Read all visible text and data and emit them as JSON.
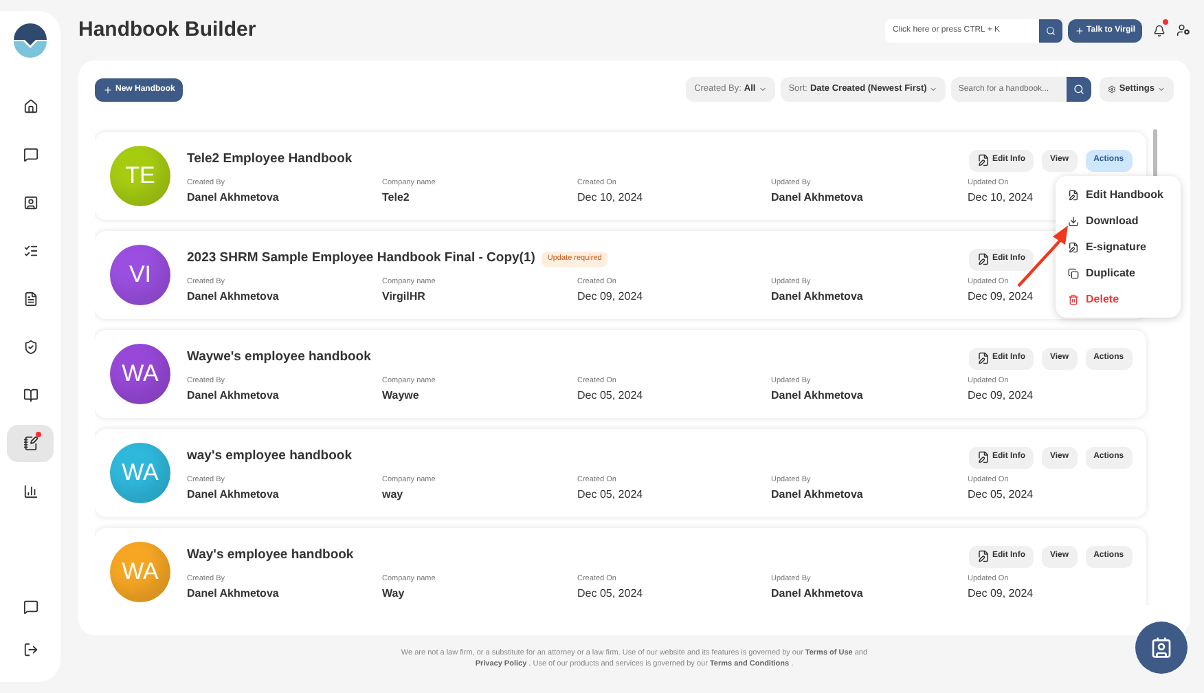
{
  "sidebar": {
    "items": [
      {
        "selected": false,
        "notification": false
      },
      {
        "selected": false,
        "notification": false
      },
      {
        "selected": false,
        "notification": false
      },
      {
        "selected": false,
        "notification": false
      },
      {
        "selected": false,
        "notification": false
      },
      {
        "selected": false,
        "notification": false
      },
      {
        "selected": false,
        "notification": false
      },
      {
        "selected": true,
        "notification": true
      },
      {
        "selected": false,
        "notification": false
      }
    ]
  },
  "header": {
    "title": "Handbook Builder",
    "search": {
      "placeholder": "Click here or press CTRL + K"
    },
    "talk_button": "Talk to Virgil",
    "notification": true
  },
  "toolbar": {
    "new_button": "New Handbook",
    "created_by": {
      "label": "Created By:",
      "value": "All"
    },
    "sort": {
      "label": "Sort:",
      "value": "Date Created (Newest First)"
    },
    "search": {
      "placeholder": "Search for a handbook..."
    },
    "settings": "Settings"
  },
  "handbooks": [
    {
      "initials": "TE",
      "color": "#a6cc12",
      "title": "Tele2 Employee Handbook",
      "fields": [
        {
          "label": "Created By",
          "value": "Danel Akhmetova"
        },
        {
          "label": "Company name",
          "value": "Tele2"
        },
        {
          "label": "Created On",
          "value": "Dec 10, 2024"
        },
        {
          "label": "Updated By",
          "value": "Danel Akhmetova"
        },
        {
          "label": "Updated On",
          "value": "Dec 10, 2024"
        }
      ],
      "buttons": [
        {
          "kind": "edit",
          "label": "Edit Info",
          "selected": false
        },
        {
          "kind": "view",
          "label": "View",
          "selected": false
        },
        {
          "kind": "actions",
          "label": "Actions",
          "selected": true
        }
      ]
    },
    {
      "initials": "VI",
      "color": "#9a4fe0",
      "title": "2023 SHRM Sample Employee Handbook Final - Copy(1)",
      "badge": "Update required",
      "fields": [
        {
          "label": "Created By",
          "value": "Danel Akhmetova"
        },
        {
          "label": "Company name",
          "value": "VirgilHR"
        },
        {
          "label": "Created On",
          "value": "Dec 09, 2024"
        },
        {
          "label": "Updated By",
          "value": "Danel Akhmetova"
        },
        {
          "label": "Updated On",
          "value": "Dec 09, 2024"
        }
      ],
      "buttons": [
        {
          "kind": "edit",
          "label": "Edit Info",
          "selected": false
        }
      ]
    },
    {
      "initials": "WA",
      "color": "#9748d8",
      "title": "Waywe's employee handbook",
      "fields": [
        {
          "label": "Created By",
          "value": "Danel Akhmetova"
        },
        {
          "label": "Company name",
          "value": "Waywe"
        },
        {
          "label": "Created On",
          "value": "Dec 05, 2024"
        },
        {
          "label": "Updated By",
          "value": "Danel Akhmetova"
        },
        {
          "label": "Updated On",
          "value": "Dec 09, 2024"
        }
      ],
      "buttons": [
        {
          "kind": "edit",
          "label": "Edit Info",
          "selected": false
        },
        {
          "kind": "view",
          "label": "View",
          "selected": false
        },
        {
          "kind": "actions",
          "label": "Actions",
          "selected": false
        }
      ]
    },
    {
      "initials": "WA",
      "color": "#2fb8dc",
      "title": "way's employee handbook",
      "fields": [
        {
          "label": "Created By",
          "value": "Danel Akhmetova"
        },
        {
          "label": "Company name",
          "value": "way"
        },
        {
          "label": "Created On",
          "value": "Dec 05, 2024"
        },
        {
          "label": "Updated By",
          "value": "Danel Akhmetova"
        },
        {
          "label": "Updated On",
          "value": "Dec 05, 2024"
        }
      ],
      "buttons": [
        {
          "kind": "edit",
          "label": "Edit Info",
          "selected": false
        },
        {
          "kind": "view",
          "label": "View",
          "selected": false
        },
        {
          "kind": "actions",
          "label": "Actions",
          "selected": false
        }
      ]
    },
    {
      "initials": "WA",
      "color": "#f6a623",
      "title": "Way's employee handbook",
      "fields": [
        {
          "label": "Created By",
          "value": "Danel Akhmetova"
        },
        {
          "label": "Company name",
          "value": "Way"
        },
        {
          "label": "Created On",
          "value": "Dec 05, 2024"
        },
        {
          "label": "Updated By",
          "value": "Danel Akhmetova"
        },
        {
          "label": "Updated On",
          "value": "Dec 09, 2024"
        }
      ],
      "buttons": [
        {
          "kind": "edit",
          "label": "Edit Info",
          "selected": false
        },
        {
          "kind": "view",
          "label": "View",
          "selected": false
        },
        {
          "kind": "actions",
          "label": "Actions",
          "selected": false
        }
      ]
    }
  ],
  "actions_menu": [
    {
      "kind": "edit",
      "label": "Edit Handbook"
    },
    {
      "kind": "download",
      "label": "Download"
    },
    {
      "kind": "esign",
      "label": "E-signature"
    },
    {
      "kind": "duplicate",
      "label": "Duplicate"
    },
    {
      "kind": "delete",
      "label": "Delete"
    }
  ],
  "footer": [
    {
      "kind": "text",
      "text": "We are not a law firm, or a substitute for an attorney or a law firm. Use of our website and its features is governed by our"
    },
    {
      "kind": "link",
      "text": "Terms of Use"
    },
    {
      "kind": "text",
      "text": "and"
    },
    {
      "kind": "link",
      "text": "Privacy Policy"
    },
    {
      "kind": "text",
      "text": ". Use of our products and services is governed by our"
    },
    {
      "kind": "link",
      "text": "Terms and Conditions"
    },
    {
      "kind": "text",
      "text": "."
    }
  ]
}
